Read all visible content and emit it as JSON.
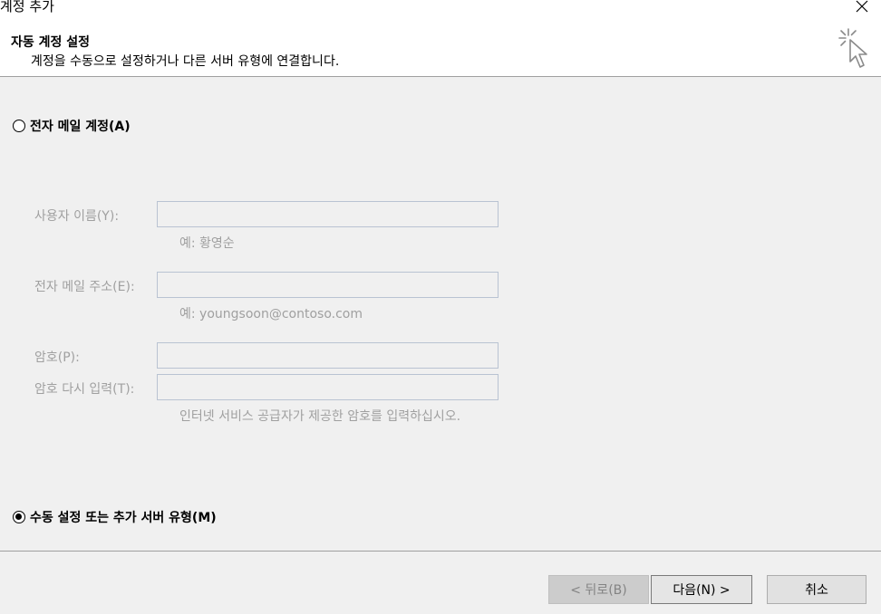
{
  "window": {
    "title": "계정 추가"
  },
  "header": {
    "title": "자동 계정 설정",
    "subtitle": "계정을 수동으로 설정하거나 다른 서버 유형에 연결합니다."
  },
  "options": {
    "email_account": {
      "label": "전자 메일 계정(A)",
      "selected": false
    },
    "manual_setup": {
      "label": "수동 설정 또는 추가 서버 유형(M)",
      "selected": true
    }
  },
  "form": {
    "name_label": "사용자 이름(Y):",
    "name_value": "",
    "name_hint": "예: 황영순",
    "email_label": "전자 메일 주소(E):",
    "email_value": "",
    "email_hint": "예: youngsoon@contoso.com",
    "password_label": "암호(P):",
    "password_value": "",
    "confirm_label": "암호 다시 입력(T):",
    "confirm_value": "",
    "password_hint": "인터넷 서비스 공급자가 제공한 암호를 입력하십시오."
  },
  "buttons": {
    "back": "< 뒤로(B)",
    "next": "다음(N) >",
    "cancel": "취소"
  },
  "icons": {
    "close": "close-icon",
    "wizard": "cursor-sparkle-icon"
  }
}
